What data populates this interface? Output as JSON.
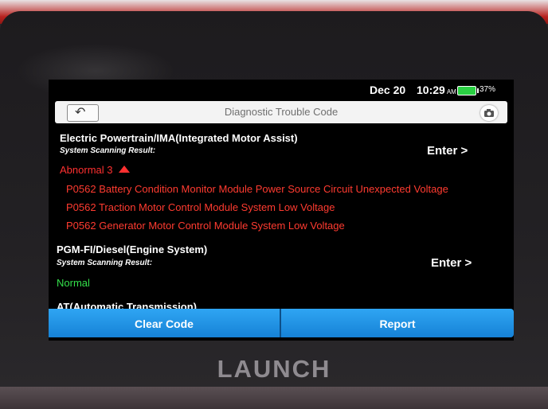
{
  "statusbar": {
    "date": "Dec 20",
    "time": "10:29",
    "ampm": "AM",
    "battery": "37%",
    "battery_color": "#2ad043"
  },
  "titlebar": {
    "title": "Diagnostic Trouble Code",
    "back_icon": "back-arrow-icon",
    "camera_icon": "camera-icon"
  },
  "systems": [
    {
      "name": "Electric Powertrain/IMA(Integrated Motor Assist)",
      "scan_label": "System Scanning Result:",
      "enter_label": "Enter >",
      "status": "Abnormal 3",
      "status_color": "#ff3030",
      "codes": [
        "P0562 Battery Condition Monitor Module Power Source Circuit Unexpected Voltage",
        "P0562 Traction Motor Control Module System Low Voltage",
        "P0562 Generator Motor Control Module System Low Voltage"
      ]
    },
    {
      "name": "PGM-FI/Diesel(Engine System)",
      "scan_label": "System Scanning Result:",
      "enter_label": "Enter >",
      "status": "Normal",
      "status_color": "#33e04a"
    },
    {
      "name": "AT(Automatic Transmission)"
    }
  ],
  "bottom_bar": {
    "clear_label": "Clear Code",
    "report_label": "Report",
    "accent": "#1e90e8"
  },
  "brand": "LAUNCH"
}
